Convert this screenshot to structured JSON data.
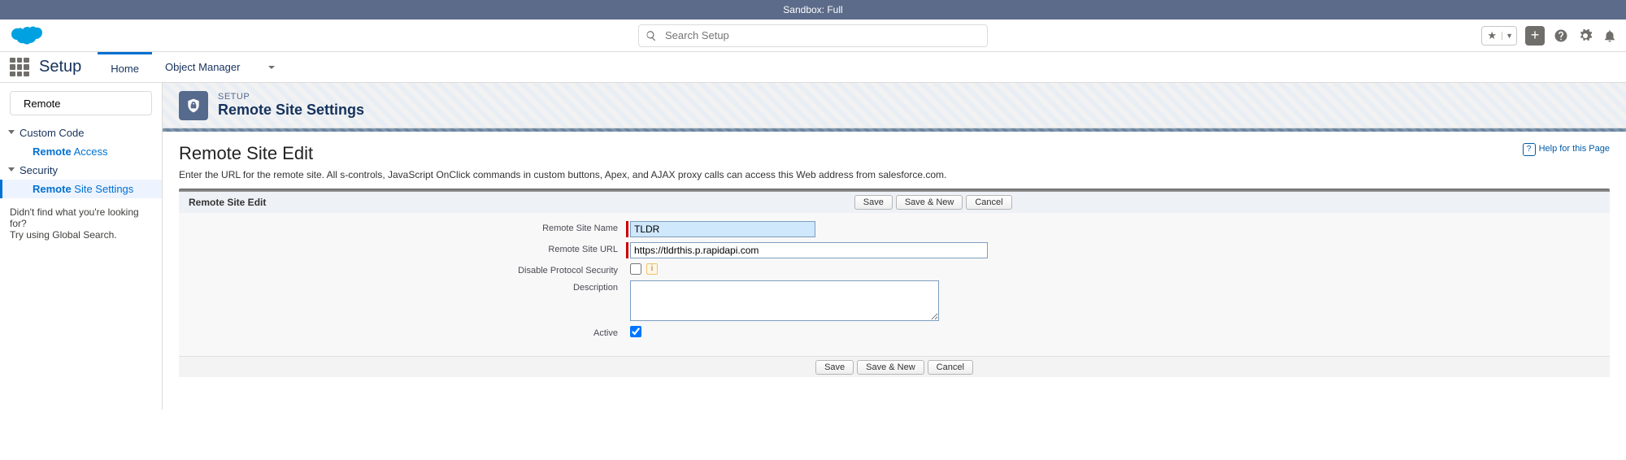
{
  "sandbox_banner": "Sandbox: Full",
  "global_search_placeholder": "Search Setup",
  "nav": {
    "title": "Setup",
    "home": "Home",
    "object_manager": "Object Manager"
  },
  "sidebar": {
    "search_value": "Remote",
    "group1": "Custom Code",
    "item1_hl": "Remote",
    "item1_rest": " Access",
    "group2": "Security",
    "item2_hl": "Remote",
    "item2_rest": " Site Settings",
    "help1": "Didn't find what you're looking for?",
    "help2": "Try using Global Search."
  },
  "page_header": {
    "eyebrow": "SETUP",
    "title": "Remote Site Settings"
  },
  "classic": {
    "page_title": "Remote Site Edit",
    "help_link": "Help for this Page",
    "intro": "Enter the URL for the remote site. All s-controls, JavaScript OnClick commands in custom buttons, Apex, and AJAX proxy calls can access this Web address from salesforce.com.",
    "section_title": "Remote Site Edit",
    "buttons": {
      "save": "Save",
      "save_new": "Save & New",
      "cancel": "Cancel"
    },
    "labels": {
      "name": "Remote Site Name",
      "url": "Remote Site URL",
      "disable": "Disable Protocol Security",
      "description": "Description",
      "active": "Active"
    },
    "values": {
      "name": "TLDR",
      "url": "https://tldrthis.p.rapidapi.com",
      "disable_checked": false,
      "description": "",
      "active_checked": true
    }
  }
}
